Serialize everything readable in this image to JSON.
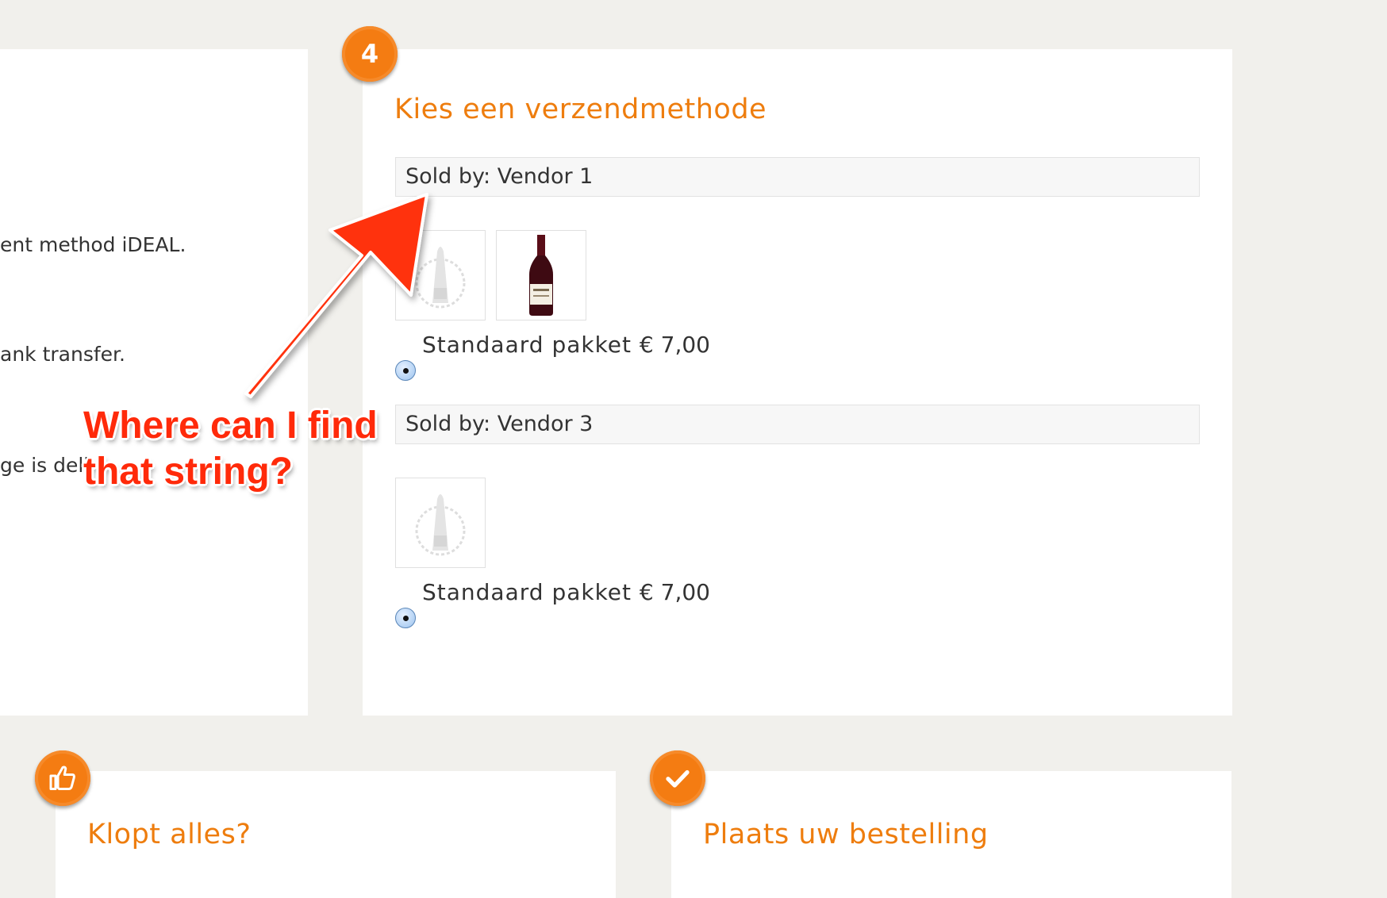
{
  "payment": {
    "lines": [
      "ent method iDEAL.",
      "ank transfer.",
      "ge is deli"
    ]
  },
  "shipping": {
    "step_number": "4",
    "title": "Kies een verzendmethode",
    "vendors": [
      {
        "sold_by": "Sold by: Vendor 1",
        "option": "Standaard pakket",
        "price": "€ 7,00"
      },
      {
        "sold_by": "Sold by: Vendor 3",
        "option": "Standaard pakket",
        "price": "€ 7,00"
      }
    ]
  },
  "check": {
    "title": "Klopt alles?",
    "icon": "thumbs-up-icon"
  },
  "order": {
    "title": "Plaats uw bestelling",
    "icon": "checkmark-icon"
  },
  "annotation": {
    "line1": "Where can I find",
    "line2": "that string?",
    "color": "#ff2a0a"
  },
  "colors": {
    "accent": "#ee7d0e",
    "badge": "#f47c12"
  }
}
